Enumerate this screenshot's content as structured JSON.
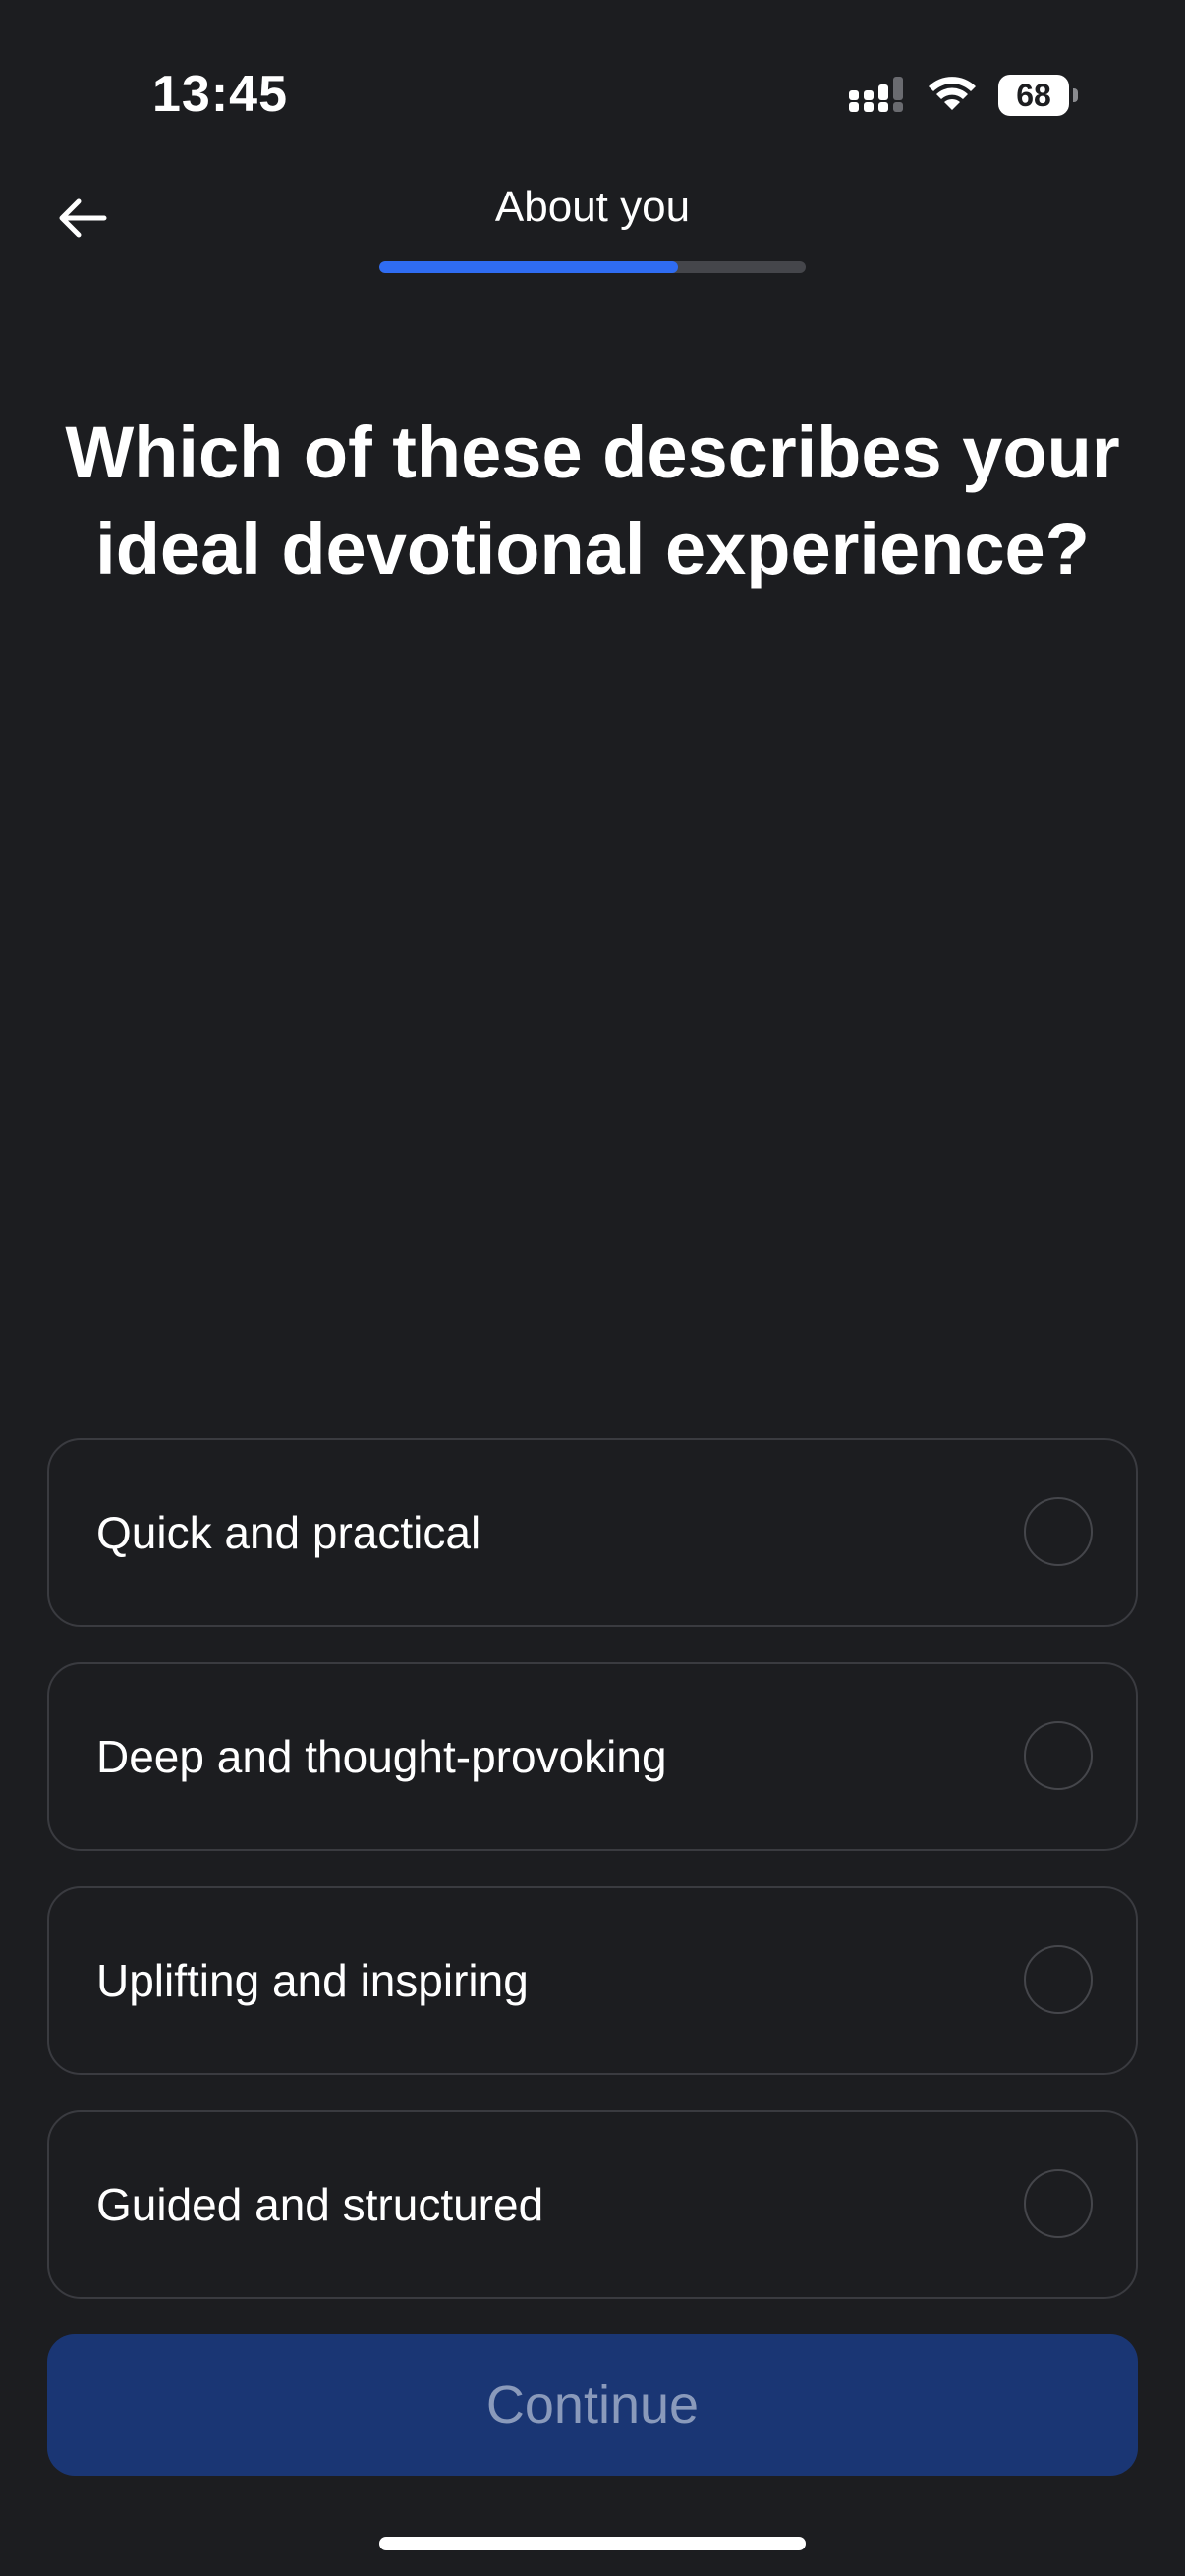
{
  "status_bar": {
    "time": "13:45",
    "battery_level": "68",
    "icons": [
      "signal-icon",
      "wifi-icon",
      "battery-icon"
    ]
  },
  "header": {
    "back_icon": "arrow-left-icon",
    "title": "About you",
    "progress_percent": 70
  },
  "question": "Which of these describes your ideal devotional experience?",
  "options": [
    {
      "label": "Quick and practical",
      "selected": false
    },
    {
      "label": "Deep and thought-provoking",
      "selected": false
    },
    {
      "label": "Uplifting and inspiring",
      "selected": false
    },
    {
      "label": "Guided and structured",
      "selected": false
    }
  ],
  "continue_label": "Continue",
  "colors": {
    "background": "#1c1d20",
    "accent": "#2f6cf2",
    "button_disabled": "#1a3674",
    "button_text_disabled": "#8a9abb"
  }
}
